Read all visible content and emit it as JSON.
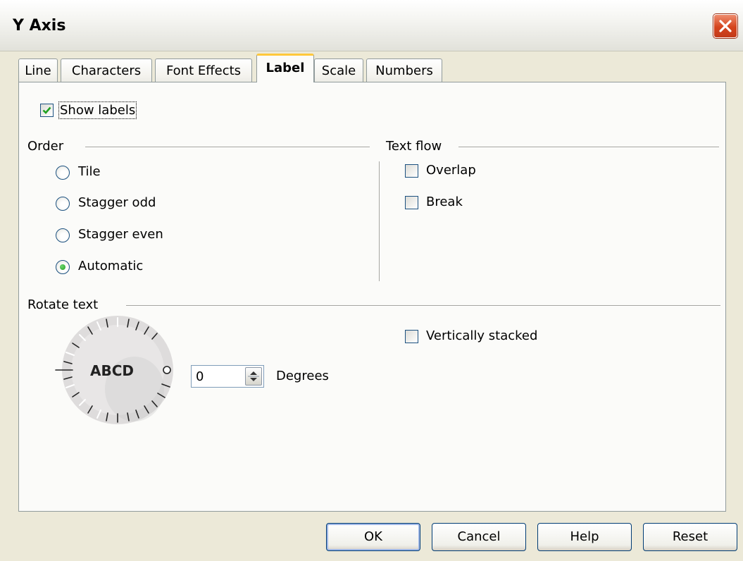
{
  "dialog": {
    "title": "Y Axis"
  },
  "tabs": [
    {
      "label": "Line",
      "active": false
    },
    {
      "label": "Characters",
      "active": false
    },
    {
      "label": "Font Effects",
      "active": false
    },
    {
      "label": "Label",
      "active": true
    },
    {
      "label": "Scale",
      "active": false
    },
    {
      "label": "Numbers",
      "active": false
    }
  ],
  "show_labels": {
    "label": "Show labels",
    "checked": true
  },
  "order": {
    "heading": "Order",
    "options": [
      {
        "label": "Tile",
        "selected": false
      },
      {
        "label": "Stagger odd",
        "selected": false
      },
      {
        "label": "Stagger even",
        "selected": false
      },
      {
        "label": "Automatic",
        "selected": true
      }
    ]
  },
  "text_flow": {
    "heading": "Text flow",
    "overlap": {
      "label": "Overlap",
      "checked": false
    },
    "break": {
      "label": "Break",
      "checked": false
    }
  },
  "rotate_text": {
    "heading": "Rotate text",
    "dial_text": "ABCD",
    "degrees_value": "0",
    "degrees_label": "Degrees",
    "vertically_stacked": {
      "label": "Vertically stacked",
      "checked": false
    }
  },
  "buttons": {
    "ok": "OK",
    "cancel": "Cancel",
    "help": "Help",
    "reset": "Reset"
  },
  "colors": {
    "dialog_bg": "#ece9d8",
    "panel_bg": "#fbfbf9",
    "active_tab_accent": "#ffc83c",
    "close_button": "#d5441d",
    "check_green": "#21a121"
  }
}
